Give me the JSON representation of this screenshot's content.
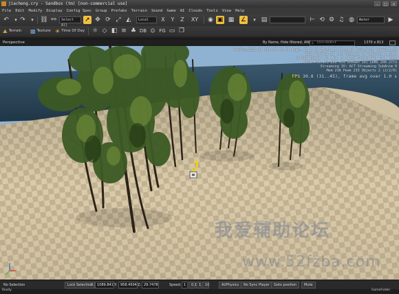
{
  "window": {
    "title": "jiacheng.cry - Sandbox (tm) [non-commercial use]"
  },
  "menu": [
    "File",
    "Edit",
    "Modify",
    "Display",
    "Config Spec",
    "Group",
    "Prefabs",
    "Terrain",
    "Sound",
    "Game",
    "AI",
    "Clouds",
    "Tools",
    "View",
    "Help"
  ],
  "toolbar": {
    "selection_filter": "Select All",
    "coord_system": "Local",
    "axis_labels": [
      "X",
      "Y",
      "Z",
      "XY"
    ],
    "material_label": "Water",
    "terrain_label": "Terrain",
    "texture_label": "Texture",
    "time_of_day_label": "Time Of Day",
    "db_label": "DB",
    "fg_label": "FG"
  },
  "viewport": {
    "name": "Perspective",
    "filter_text": "By Name, Hide filtered, AND",
    "search_placeholder": "Ctrl+Shift+F",
    "resolution": "1370 x 813"
  },
  "debug_overlay": {
    "lines": [
      "CamPos=1092.04 953.45 30.35 Angl= 25 0 28 ZNr=0.25 FC=2.40 Zoom=1.00 Speed=1.00",
      "DX9 Profile GT 240 OnGwgge 01 OnGsxxx 1.5047",
      "(9 DX9 Shader 9) Tri: 0 (125) ShadowGen 1024 2066",
      "(0)9 F(0,17) 200 ASS ShdGen 10) LKMS 200 2773",
      "Streaming IO: ACT Streaming SubAnim 0",
      "Mem 236 Peak 233 Objects 2 (2/2/8)"
    ],
    "fps_line": "FPS 30.8 (31..45), frame avg over 1.0 s"
  },
  "watermark": {
    "text": "我爱辅助论坛",
    "url": "www.52fzba.com"
  },
  "statusbar": {
    "selection": "No Selection",
    "lock_selection": "Lock Selection",
    "x_label": "X:",
    "x_value": "1089.841",
    "y_label": "Y:",
    "y_value": "958.4504",
    "z_label": "Z:",
    "z_value": "29.7478",
    "speed_label": "Speed:",
    "speed_options": [
      "1",
      "0.1",
      "1",
      "10"
    ],
    "ai_physics": "AI/Physics",
    "no_sync_player": "No Sync Player",
    "goto_position": "Goto position",
    "mute": "Mute"
  },
  "readybar": {
    "left": "Ready",
    "right": "GameFolder"
  },
  "colors": {
    "highlight": "#f0c040",
    "sky": "#6e8fb0",
    "sea": "#2e4a5e",
    "tile_light": "#d8c9aa",
    "tile_dark": "#bfae8c"
  }
}
